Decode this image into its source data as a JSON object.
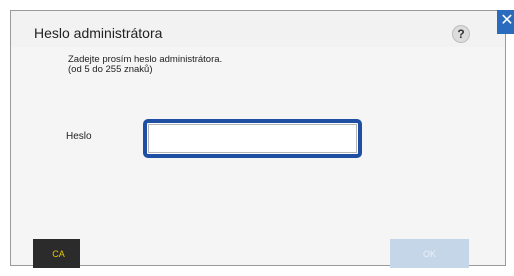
{
  "dialog": {
    "title": "Heslo administrátora",
    "help_label": "?",
    "close_label": "✕",
    "instruction_line1": "Zadejte prosím heslo administrátora.",
    "instruction_line2": "(od 5 do 255 znaků)"
  },
  "form": {
    "password_label": "Heslo",
    "password_value": "",
    "password_placeholder": ""
  },
  "buttons": {
    "ca_label": "CA",
    "ok_label": "OK",
    "ok_enabled": false
  },
  "colors": {
    "accent": "#1f4fa3",
    "close_bg": "#2a6bbd",
    "ca_bg": "#2b2b2b",
    "ca_text": "#e8c800",
    "ok_disabled_bg": "#c5d6e8"
  }
}
